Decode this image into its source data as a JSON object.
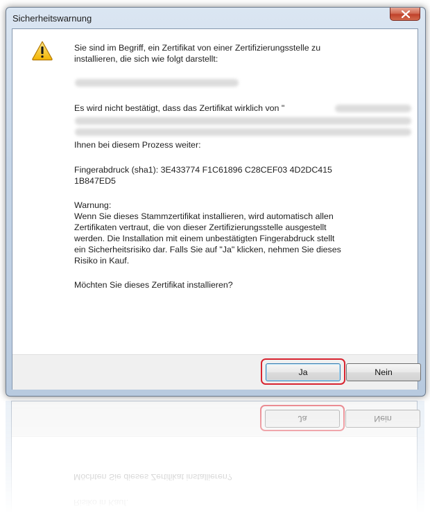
{
  "window": {
    "title": "Sicherheitswarnung"
  },
  "icons": {
    "warning": "warning-triangle-icon",
    "close": "close-x-icon"
  },
  "message": {
    "line1": "Sie sind im Begriff, ein Zertifikat von einer Zertifizierungsstelle zu",
    "line2": "installieren, die sich wie folgt darstellt:",
    "verify_prefix": "Es wird nicht bestätigt, dass das Zertifikat wirklich von \"",
    "verify_suffix": "Ihnen bei diesem Prozess weiter:",
    "thumbprint_line1": "Fingerabdruck (sha1): 3E433774 F1C61896 C28CEF03 4D2DC415",
    "thumbprint_line2": "1B847ED5",
    "warning_heading": "Warnung:",
    "warning_line1": "Wenn Sie dieses Stammzertifikat installieren, wird automatisch allen",
    "warning_line2": "Zertifikaten vertraut, die von dieser Zertifizierungsstelle ausgestellt",
    "warning_line3": "werden. Die Installation mit einem unbestätigten Fingerabdruck stellt",
    "warning_line4": "ein Sicherheitsrisiko dar. Falls Sie auf \"Ja\" klicken, nehmen Sie dieses",
    "warning_line5": "Risiko in Kauf.",
    "question": "Möchten Sie dieses Zertifikat installieren?"
  },
  "buttons": {
    "yes": "Ja",
    "no": "Nein"
  },
  "colors": {
    "highlight": "#d8232f",
    "warning_icon": "#f5c400"
  }
}
